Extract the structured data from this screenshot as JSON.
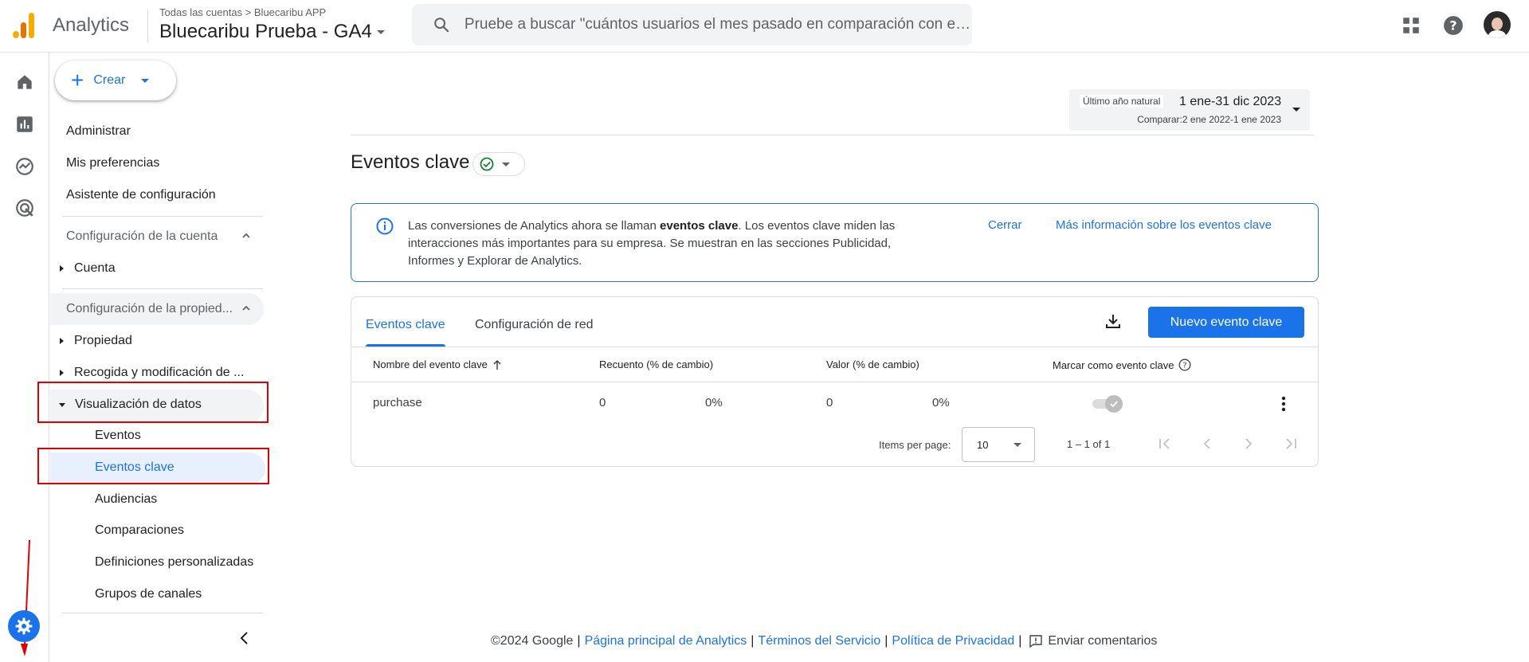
{
  "header": {
    "app_name": "Analytics",
    "breadcrumb": "Todas las cuentas > Bluecaribu APP",
    "property_name": "Bluecaribu Prueba - GA4",
    "search_placeholder": "Pruebe a buscar \"cuántos usuarios el mes pasado en comparación con el ...",
    "icons": [
      "apps-grid-icon",
      "help-icon",
      "avatar"
    ]
  },
  "rail": {
    "icons": [
      "home-icon",
      "reports-icon",
      "explore-icon",
      "advertising-icon",
      "admin-gear-icon"
    ]
  },
  "nav": {
    "create_label": "Crear",
    "admin": "Administrar",
    "preferences": "Mis preferencias",
    "setup_assistant": "Asistente de configuración",
    "account_section": "Configuración de la cuenta",
    "account_item": "Cuenta",
    "property_section": "Configuración de la propied...",
    "property_item": "Propiedad",
    "collection_item": "Recogida y modificación de ...",
    "data_display": "Visualización de datos",
    "sub_items": [
      "Eventos",
      "Eventos clave",
      "Audiencias",
      "Comparaciones",
      "Definiciones personalizadas",
      "Grupos de canales"
    ],
    "selected": "Eventos clave"
  },
  "date_range": {
    "label": "Último año natural",
    "range": "1 ene-31 dic 2023",
    "compare": "Comparar:2 ene 2022-1 ene 2023"
  },
  "page": {
    "title": "Eventos clave"
  },
  "banner": {
    "text_before": "Las conversiones de Analytics ahora se llaman ",
    "text_bold": "eventos clave",
    "text_after": ". Los eventos clave miden las interacciones más importantes para su empresa. Se muestran en las secciones Publicidad, Informes y Explorar de Analytics.",
    "close_label": "Cerrar",
    "learn_more_label": "Más información sobre los eventos clave"
  },
  "card": {
    "tabs": [
      "Eventos clave",
      "Configuración de red"
    ],
    "new_button": "Nuevo evento clave",
    "columns": [
      "Nombre del evento clave",
      "Recuento (% de cambio)",
      "Valor (% de cambio)",
      "Marcar como evento clave"
    ],
    "rows": [
      {
        "name": "purchase",
        "count": "0",
        "count_change": "0%",
        "value": "0",
        "value_change": "0%",
        "marked": true
      }
    ],
    "pagination": {
      "items_per_page_label": "Items per page:",
      "items_per_page": "10",
      "range": "1 – 1 of 1"
    }
  },
  "footer": {
    "copyright": "©2024 Google",
    "links": [
      "Página principal de Analytics",
      "Términos del Servicio",
      "Política de Privacidad"
    ],
    "feedback": "Enviar comentarios"
  },
  "colors": {
    "accent": "#1a73e8",
    "annotation_red": "#e10000",
    "selected_bg": "#e8f0fe"
  }
}
